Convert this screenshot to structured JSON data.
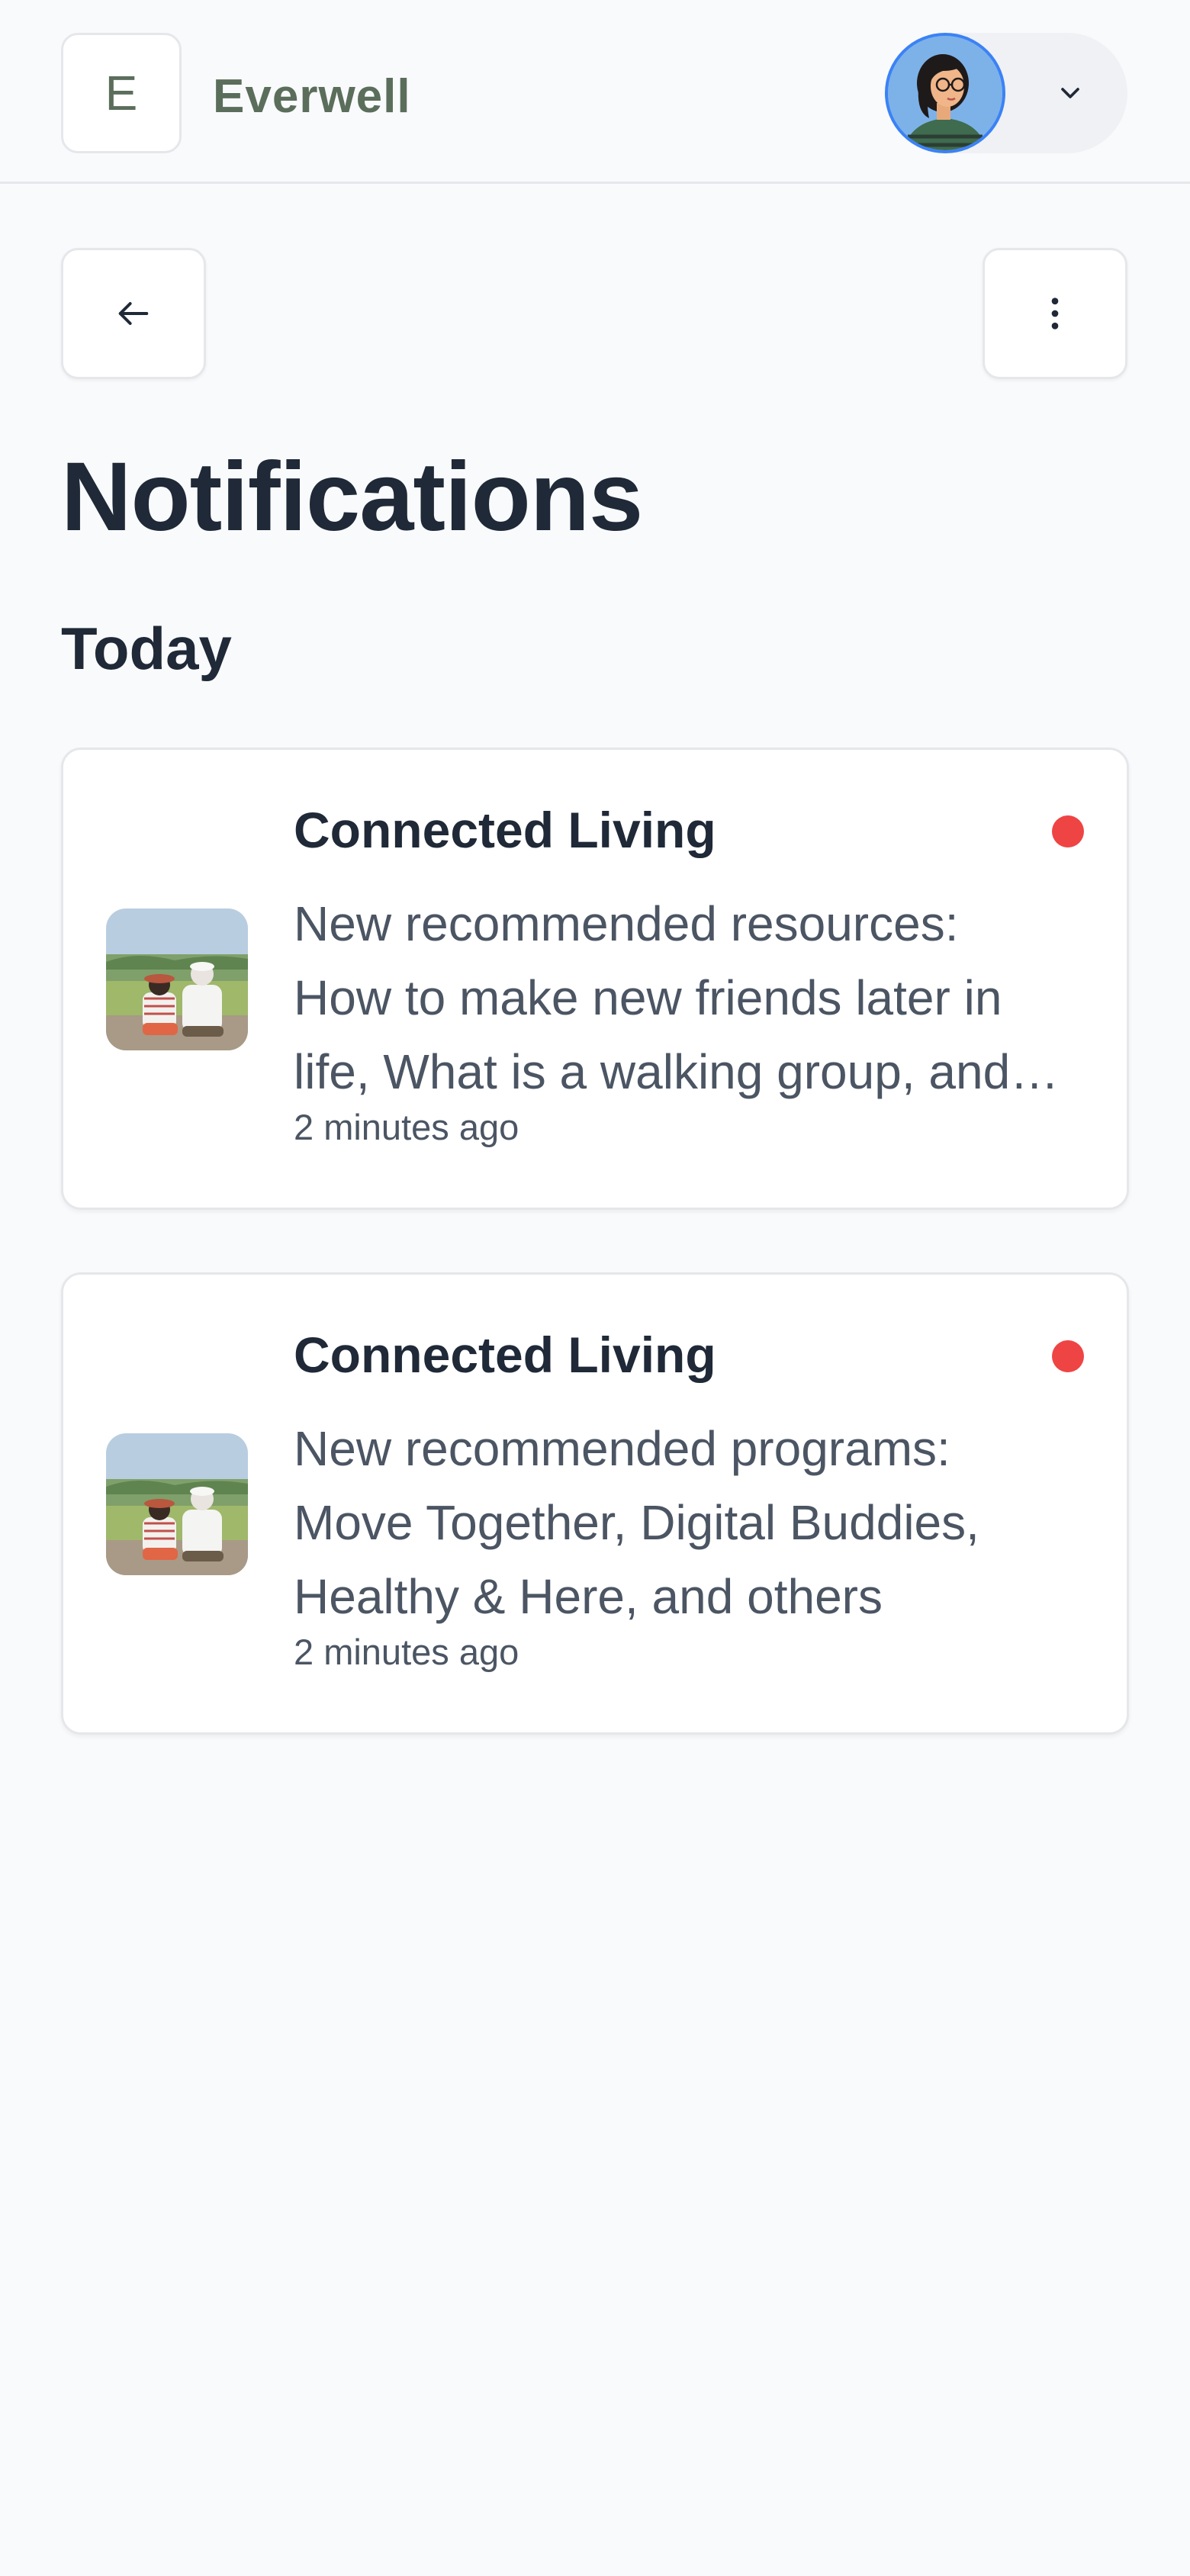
{
  "header": {
    "logo_letter": "E",
    "brand_name": "Everwell",
    "avatar_icon": "user-avatar",
    "menu_icon": "chevron-down-icon"
  },
  "toolbar": {
    "back_icon": "arrow-left-icon",
    "more_icon": "more-vertical-icon"
  },
  "page": {
    "title": "Notifications",
    "section_today": "Today"
  },
  "notifications": [
    {
      "title": "Connected Living",
      "body": "New recommended resources: How to make new friends later in life, What is a walking group, and more",
      "time": "2 minutes ago",
      "unread": true
    },
    {
      "title": "Connected Living",
      "body": "New recommended programs: Move Together, Digital Buddies, Healthy & Here, and others",
      "time": "2 minutes ago",
      "unread": true
    }
  ],
  "colors": {
    "brand": "#5b6d5b",
    "unread": "#ef4444",
    "avatar_ring": "#3b82f6"
  }
}
